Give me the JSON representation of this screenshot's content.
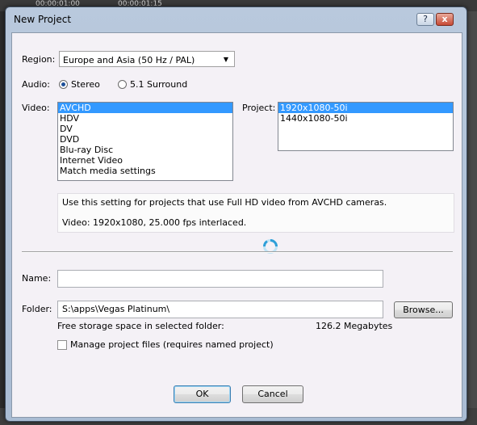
{
  "background": {
    "timecodes": [
      "00:00:01:00",
      "00:00:01:15"
    ]
  },
  "dialog": {
    "title": "New Project",
    "help_label": "?",
    "close_label": "x"
  },
  "region": {
    "label": "Region:",
    "value": "Europe and Asia (50 Hz / PAL)"
  },
  "audio": {
    "label": "Audio:",
    "options": [
      {
        "label": "Stereo",
        "selected": true
      },
      {
        "label": "5.1 Surround",
        "selected": false
      }
    ]
  },
  "video": {
    "label": "Video:",
    "items": [
      {
        "label": "AVCHD",
        "selected": true
      },
      {
        "label": "HDV",
        "selected": false
      },
      {
        "label": "DV",
        "selected": false
      },
      {
        "label": "DVD",
        "selected": false
      },
      {
        "label": "Blu-ray Disc",
        "selected": false
      },
      {
        "label": "Internet Video",
        "selected": false
      },
      {
        "label": "Match media settings",
        "selected": false
      }
    ]
  },
  "project": {
    "label": "Project:",
    "items": [
      {
        "label": "1920x1080-50i",
        "selected": true
      },
      {
        "label": "1440x1080-50i",
        "selected": false
      }
    ]
  },
  "info": {
    "description": "Use this setting for projects that use Full HD video from AVCHD cameras.",
    "details": "Video: 1920x1080, 25.000 fps interlaced."
  },
  "name": {
    "label": "Name:",
    "value": ""
  },
  "folder": {
    "label": "Folder:",
    "value": "S:\\apps\\Vegas Platinum\\",
    "browse_label": "Browse...",
    "free_space_label": "Free storage space in selected folder:",
    "free_space_value": "126.2 Megabytes"
  },
  "manage_files": {
    "label": "Manage project files (requires named project)",
    "checked": false
  },
  "buttons": {
    "ok": "OK",
    "cancel": "Cancel"
  },
  "colors": {
    "selection": "#3399ff",
    "radio_dot": "#1d4f98",
    "spinner": "#2e9fd8"
  }
}
